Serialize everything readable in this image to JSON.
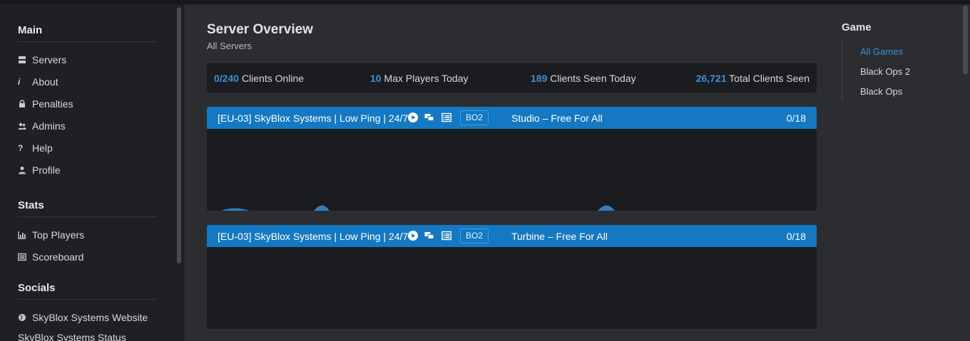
{
  "sidebar": {
    "main_heading": "Main",
    "main_items": [
      {
        "label": "Servers",
        "icon": "server-icon"
      },
      {
        "label": "About",
        "icon": "info-icon"
      },
      {
        "label": "Penalties",
        "icon": "lock-icon"
      },
      {
        "label": "Admins",
        "icon": "users-icon"
      },
      {
        "label": "Help",
        "icon": "question-icon"
      },
      {
        "label": "Profile",
        "icon": "user-icon"
      }
    ],
    "stats_heading": "Stats",
    "stats_items": [
      {
        "label": "Top Players",
        "icon": "bar-chart-icon"
      },
      {
        "label": "Scoreboard",
        "icon": "list-icon"
      }
    ],
    "socials_heading": "Socials",
    "socials_items": [
      {
        "label": "SkyBlox Systems Website",
        "icon": "globe-icon"
      },
      {
        "label": "SkyBlox Systems Status",
        "icon": ""
      }
    ]
  },
  "main": {
    "title": "Server Overview",
    "subtitle": "All Servers",
    "stats": {
      "clients_online_num": "0/240",
      "clients_online_label": "Clients Online",
      "max_players_num": "10",
      "max_players_label": "Max Players Today",
      "seen_today_num": "189",
      "seen_today_label": "Clients Seen Today",
      "total_seen_num": "26,721",
      "total_seen_label": "Total Clients Seen"
    },
    "servers": [
      {
        "name": "[EU-03] SkyBlox Systems | Low Ping | 24/7",
        "game": "BO2",
        "map": "Studio – Free For All",
        "players": "0/18"
      },
      {
        "name": "[EU-03] SkyBlox Systems | Low Ping | 24/7",
        "game": "BO2",
        "map": "Turbine – Free For All",
        "players": "0/18"
      }
    ]
  },
  "games": {
    "heading": "Game",
    "items": [
      {
        "label": "All Games",
        "active": true
      },
      {
        "label": "Black Ops 2",
        "active": false
      },
      {
        "label": "Black Ops",
        "active": false
      }
    ]
  },
  "colors": {
    "accent": "#1478c2",
    "highlight": "#3d8fd8",
    "background": "#2b2d30",
    "sidebar": "#1f2023",
    "panel": "#1b1c1f"
  }
}
